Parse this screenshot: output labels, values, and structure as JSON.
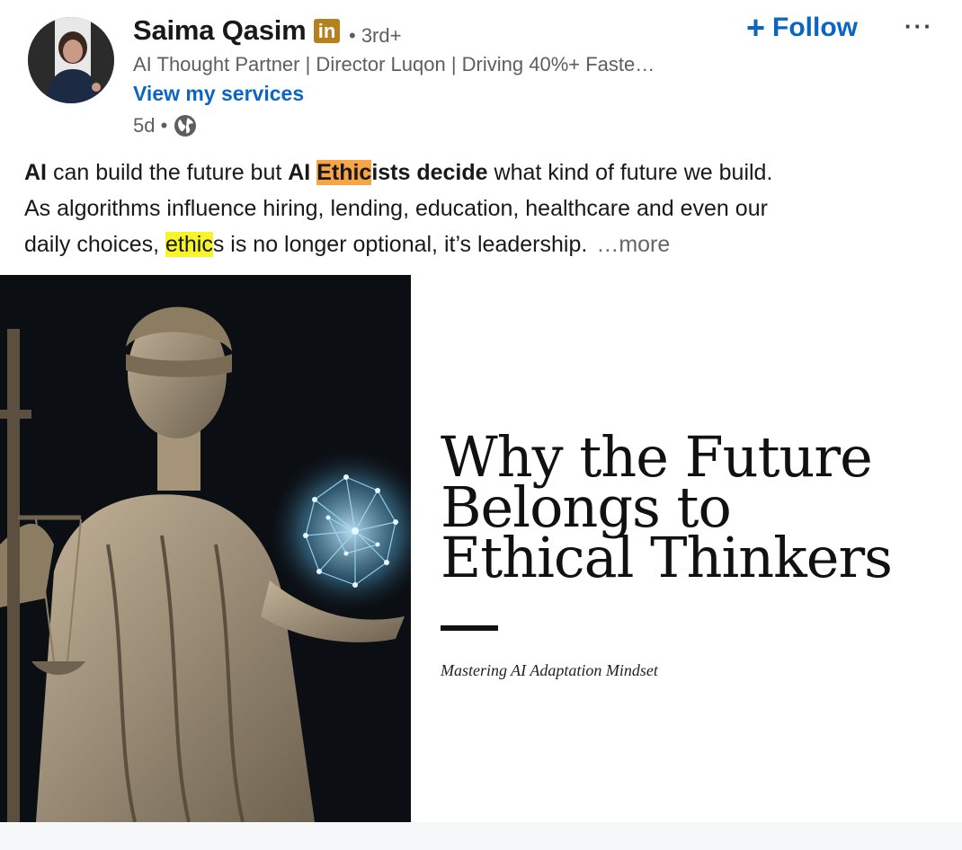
{
  "author": {
    "name": "Saima Qasim",
    "badge": "in",
    "degree": "• 3rd+",
    "headline": "AI Thought Partner | Director Luqon | Driving 40%+ Faste…",
    "services_link": "View my services",
    "time": "5d •",
    "visibility_icon": "globe-icon"
  },
  "actions": {
    "follow_plus": "+",
    "follow_label": "Follow",
    "more_icon": "···"
  },
  "post": {
    "line1_a": "AI",
    "line1_b": " can build the future but ",
    "line1_c": "AI ",
    "line1_d": "Ethic",
    "line1_e": "ists decide",
    "line1_f": " what kind of future we build.",
    "line2": "As algorithms influence hiring, lending, education, healthcare and even our",
    "line3_a": "daily choices, ",
    "line3_b": "ethic",
    "line3_c": "s is no longer optional, it’s leadership.",
    "see_more": "…more"
  },
  "image": {
    "title_line1": "Why the Future",
    "title_line2": "Belongs to",
    "title_line3": "Ethical Thinkers",
    "subtitle": "Mastering AI Adaptation Mindset"
  },
  "colors": {
    "brand_blue": "#0a66c2",
    "badge_gold": "#b5801f",
    "highlight_orange": "#f7a546",
    "highlight_yellow": "#f5f52a"
  }
}
